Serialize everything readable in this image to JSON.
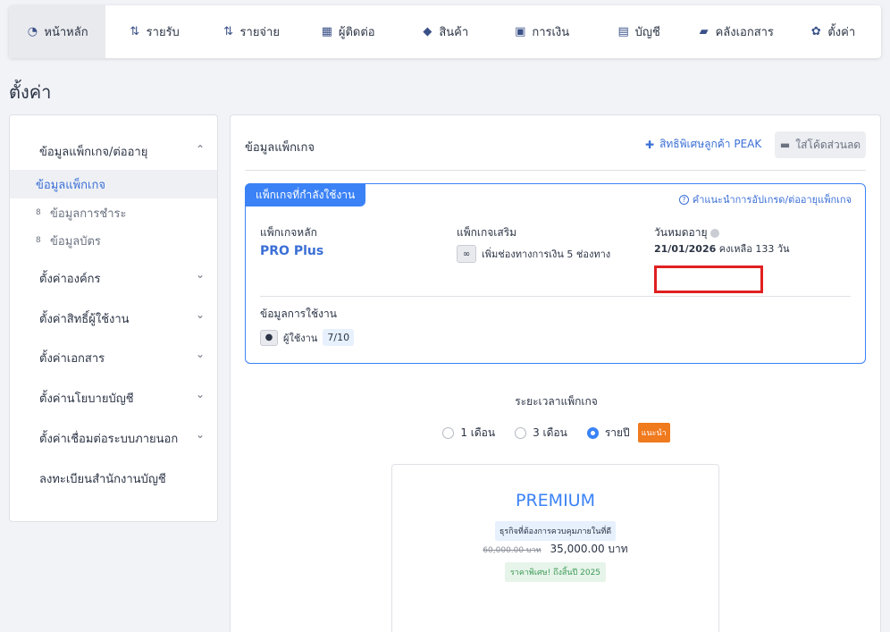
{
  "nav": {
    "items": [
      {
        "label": "หน้าหลัก",
        "icon": "dashboard-icon",
        "glyph": "◔"
      },
      {
        "label": "รายรับ",
        "icon": "income-icon",
        "glyph": "⇅"
      },
      {
        "label": "รายจ่าย",
        "icon": "expense-icon",
        "glyph": "⇅"
      },
      {
        "label": "ผู้ติดต่อ",
        "icon": "contacts-icon",
        "glyph": "▦"
      },
      {
        "label": "สินค้า",
        "icon": "product-box-icon",
        "glyph": "◆"
      },
      {
        "label": "การเงิน",
        "icon": "money-icon",
        "glyph": "▣"
      },
      {
        "label": "บัญชี",
        "icon": "ledger-book-icon",
        "glyph": "▤"
      },
      {
        "label": "คลังเอกสาร",
        "icon": "folder-icon",
        "glyph": "▰"
      },
      {
        "label": "ตั้งค่า",
        "icon": "gear-icon",
        "glyph": "✿"
      }
    ]
  },
  "page": {
    "title": "ตั้งค่า"
  },
  "sidebar": {
    "group_package": "ข้อมูลแพ็กเกจ/ต่ออายุ",
    "sub_package": "ข้อมูลแพ็กเกจ",
    "sub_payment": "ข้อมูลการชำระ",
    "sub_card": "ข้อมูลบัตร",
    "group_org": "ตั้งค่าองค์กร",
    "group_user_rights": "ตั้งค่าสิทธิ์ผู้ใช้งาน",
    "group_documents": "ตั้งค่าเอกสาร",
    "group_accounting_policy": "ตั้งค่านโยบายบัญชี",
    "group_integrations": "ตั้งค่าเชื่อมต่อระบบภายนอก",
    "register_accounting_office": "ลงทะเบียนสำนักงานบัญชี"
  },
  "main": {
    "title": "ข้อมูลแพ็กเกจ",
    "privilege_link": "สิทธิพิเศษลูกค้า PEAK",
    "discount_button": "ใส่โค้ดส่วนลด",
    "current_package_tag": "แพ็กเกจที่กำลังใช้งาน",
    "upgrade_link": "คำแนะนำการอัปเกรด/ต่ออายุแพ็กเกจ",
    "main_package_label": "แพ็กเกจหลัก",
    "main_package_value": "PRO Plus",
    "addon_label": "แพ็กเกจเสริม",
    "addon_value": "เพิ่มช่องทางการเงิน 5 ช่องทาง",
    "expire_label": "วันหมดอายุ",
    "expire_date": "21/01/2026",
    "expire_remaining": "คงเหลือ 133 วัน",
    "usage_title": "ข้อมูลการใช้งาน",
    "users_label": "ผู้ใช้งาน",
    "users_count": "7/10",
    "period_title": "ระยะเวลาแพ็กเกจ",
    "period_options": [
      "1 เดือน",
      "3 เดือน",
      "รายปี"
    ],
    "period_selected": "รายปี",
    "recommend_badge": "แนะนำ",
    "plan": {
      "name": "PREMIUM",
      "description": "ธุรกิจที่ต้องการควบคุมภายในที่ดี",
      "old_price": "60,000.00 บาท",
      "price": "35,000.00 บาท",
      "promo": "ราคาพิเศษ! ถึงสิ้นปี 2025"
    }
  }
}
